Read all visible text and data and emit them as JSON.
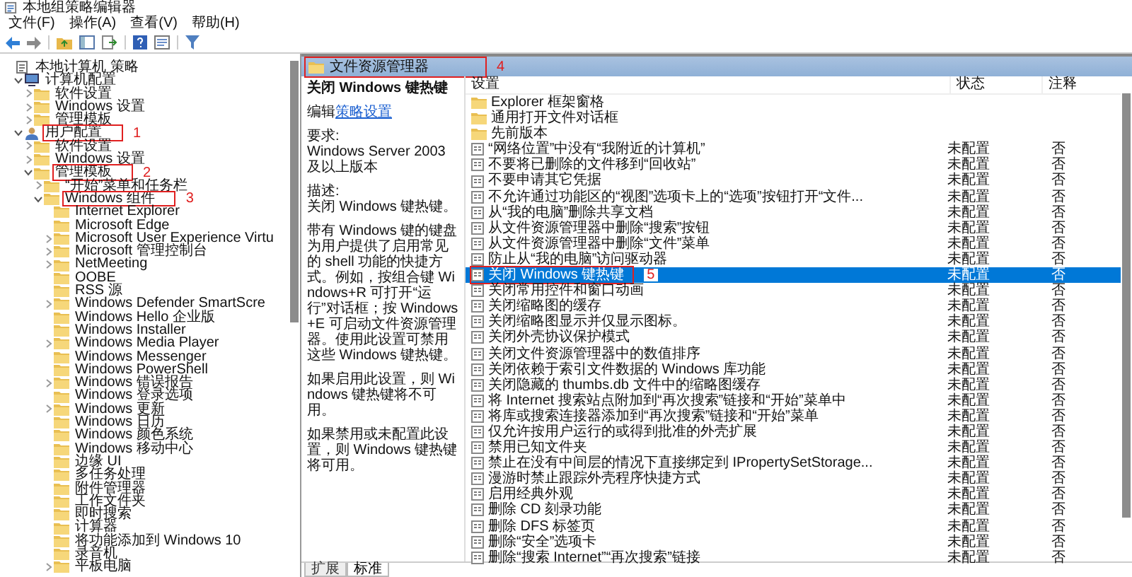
{
  "window": {
    "title": "本地组策略编辑器"
  },
  "menu": [
    "文件(F)",
    "操作(A)",
    "查看(V)",
    "帮助(H)"
  ],
  "tree": [
    {
      "kind": "policy",
      "label": "本地计算机 策略",
      "children": [
        {
          "kind": "computer",
          "label": "计算机配置",
          "expanded": true,
          "children": [
            {
              "kind": "folder",
              "label": "软件设置",
              "expanded": false
            },
            {
              "kind": "folder",
              "label": "Windows 设置",
              "expanded": false
            },
            {
              "kind": "folder",
              "label": "管理模板",
              "expanded": false
            }
          ]
        },
        {
          "kind": "user",
          "label": "用户配置",
          "expanded": true,
          "callout": "1",
          "children": [
            {
              "kind": "folder",
              "label": "软件设置",
              "expanded": false
            },
            {
              "kind": "folder",
              "label": "Windows 设置",
              "expanded": false
            },
            {
              "kind": "folder",
              "label": "管理模板",
              "expanded": true,
              "callout": "2",
              "children": [
                {
                  "kind": "folder",
                  "label": "“开始”菜单和任务栏",
                  "expanded": false
                },
                {
                  "kind": "folder",
                  "label": "Windows 组件",
                  "expanded": true,
                  "callout": "3",
                  "children": [
                    {
                      "kind": "folder",
                      "label": "Internet Explorer"
                    },
                    {
                      "kind": "folder",
                      "label": "Microsoft Edge"
                    },
                    {
                      "kind": "folder",
                      "label": "Microsoft User Experience Virtu",
                      "expanded": false
                    },
                    {
                      "kind": "folder",
                      "label": "Microsoft 管理控制台",
                      "expanded": false
                    },
                    {
                      "kind": "folder",
                      "label": "NetMeeting",
                      "expanded": false
                    },
                    {
                      "kind": "folder",
                      "label": "OOBE"
                    },
                    {
                      "kind": "folder",
                      "label": "RSS 源"
                    },
                    {
                      "kind": "folder",
                      "label": "Windows Defender SmartScre",
                      "expanded": false
                    },
                    {
                      "kind": "folder",
                      "label": "Windows Hello 企业版"
                    },
                    {
                      "kind": "folder",
                      "label": "Windows Installer"
                    },
                    {
                      "kind": "folder",
                      "label": "Windows Media Player",
                      "expanded": false
                    },
                    {
                      "kind": "folder",
                      "label": "Windows Messenger"
                    },
                    {
                      "kind": "folder",
                      "label": "Windows PowerShell"
                    },
                    {
                      "kind": "folder",
                      "label": "Windows 错误报告",
                      "expanded": false
                    },
                    {
                      "kind": "folder",
                      "label": "Windows 登录选项"
                    },
                    {
                      "kind": "folder",
                      "label": "Windows 更新",
                      "expanded": false
                    },
                    {
                      "kind": "folder",
                      "label": "Windows 日历"
                    },
                    {
                      "kind": "folder",
                      "label": "Windows 颜色系统"
                    },
                    {
                      "kind": "folder",
                      "label": "Windows 移动中心"
                    },
                    {
                      "kind": "folder",
                      "label": "边缘 UI"
                    },
                    {
                      "kind": "folder",
                      "label": "多任务处理"
                    },
                    {
                      "kind": "folder",
                      "label": "附件管理器"
                    },
                    {
                      "kind": "folder",
                      "label": "工作文件夹"
                    },
                    {
                      "kind": "folder",
                      "label": "即时搜索"
                    },
                    {
                      "kind": "folder",
                      "label": "计算器"
                    },
                    {
                      "kind": "folder",
                      "label": "将功能添加到 Windows 10"
                    },
                    {
                      "kind": "folder",
                      "label": "录音机"
                    },
                    {
                      "kind": "folder",
                      "label": "平板电脑",
                      "expanded": false
                    }
                  ]
                }
              ]
            }
          ]
        }
      ]
    }
  ],
  "header": {
    "title": "文件资源管理器",
    "callout": "4"
  },
  "description": {
    "title": "关闭 Windows 键热键",
    "edit_prefix": "编辑",
    "edit_link": "策略设置",
    "requirement_label": "要求:",
    "requirement": "Windows Server 2003 及以上版本",
    "description_label": "描述:",
    "paragraphs": [
      "关闭 Windows 键热键。",
      "带有 Windows 键的键盘为用户提供了启用常见的 shell 功能的快捷方式。例如，按组合键 Windows+R 可打开“运行”对话框；按 Windows+E 可启动文件资源管理器。使用此设置可禁用这些 Windows 键热键。",
      "如果启用此设置，则 Windows 键热键将不可用。",
      "如果禁用或未配置此设置，则 Windows 键热键将可用。"
    ]
  },
  "table": {
    "columns": [
      "设置",
      "状态",
      "注释"
    ],
    "rows": [
      {
        "kind": "folder",
        "name": "Explorer 框架窗格",
        "selected": false
      },
      {
        "kind": "folder",
        "name": "通用打开文件对话框",
        "selected": false
      },
      {
        "kind": "folder",
        "name": "先前版本",
        "selected": false
      },
      {
        "kind": "setting",
        "name": "“网络位置”中没有“我附近的计算机”",
        "state": "未配置",
        "comment": "否",
        "selected": false
      },
      {
        "kind": "setting",
        "name": "不要将已删除的文件移到“回收站”",
        "state": "未配置",
        "comment": "否",
        "selected": false
      },
      {
        "kind": "setting",
        "name": "不要申请其它凭据",
        "state": "未配置",
        "comment": "否",
        "selected": false
      },
      {
        "kind": "setting",
        "name": "不允许通过功能区的“视图”选项卡上的“选项”按钮打开“文件...",
        "state": "未配置",
        "comment": "否",
        "selected": false
      },
      {
        "kind": "setting",
        "name": "从“我的电脑”删除共享文档",
        "state": "未配置",
        "comment": "否",
        "selected": false
      },
      {
        "kind": "setting",
        "name": "从文件资源管理器中删除“搜索”按钮",
        "state": "未配置",
        "comment": "否",
        "selected": false
      },
      {
        "kind": "setting",
        "name": "从文件资源管理器中删除“文件”菜单",
        "state": "未配置",
        "comment": "否",
        "selected": false
      },
      {
        "kind": "setting",
        "name": "防止从“我的电脑”访问驱动器",
        "state": "未配置",
        "comment": "否",
        "selected": false
      },
      {
        "kind": "setting",
        "name": "关闭 Windows 键热键",
        "state": "未配置",
        "comment": "否",
        "selected": true,
        "callout": "5"
      },
      {
        "kind": "setting",
        "name": "关闭常用控件和窗口动画",
        "state": "未配置",
        "comment": "否",
        "selected": false
      },
      {
        "kind": "setting",
        "name": "关闭缩略图的缓存",
        "state": "未配置",
        "comment": "否",
        "selected": false
      },
      {
        "kind": "setting",
        "name": "关闭缩略图显示并仅显示图标。",
        "state": "未配置",
        "comment": "否",
        "selected": false
      },
      {
        "kind": "setting",
        "name": "关闭外壳协议保护模式",
        "state": "未配置",
        "comment": "否",
        "selected": false
      },
      {
        "kind": "setting",
        "name": "关闭文件资源管理器中的数值排序",
        "state": "未配置",
        "comment": "否",
        "selected": false
      },
      {
        "kind": "setting",
        "name": "关闭依赖于索引文件数据的 Windows 库功能",
        "state": "未配置",
        "comment": "否",
        "selected": false
      },
      {
        "kind": "setting",
        "name": "关闭隐藏的 thumbs.db 文件中的缩略图缓存",
        "state": "未配置",
        "comment": "否",
        "selected": false
      },
      {
        "kind": "setting",
        "name": "将 Internet 搜索站点附加到“再次搜索”链接和“开始”菜单中",
        "state": "未配置",
        "comment": "否",
        "selected": false
      },
      {
        "kind": "setting",
        "name": "将库或搜索连接器添加到“再次搜索”链接和“开始”菜单",
        "state": "未配置",
        "comment": "否",
        "selected": false
      },
      {
        "kind": "setting",
        "name": "仅允许按用户运行的或得到批准的外壳扩展",
        "state": "未配置",
        "comment": "否",
        "selected": false
      },
      {
        "kind": "setting",
        "name": "禁用已知文件夹",
        "state": "未配置",
        "comment": "否",
        "selected": false
      },
      {
        "kind": "setting",
        "name": "禁止在没有中间层的情况下直接绑定到 IPropertySetStorage...",
        "state": "未配置",
        "comment": "否",
        "selected": false
      },
      {
        "kind": "setting",
        "name": "漫游时禁止跟踪外壳程序快捷方式",
        "state": "未配置",
        "comment": "否",
        "selected": false
      },
      {
        "kind": "setting",
        "name": "启用经典外观",
        "state": "未配置",
        "comment": "否",
        "selected": false
      },
      {
        "kind": "setting",
        "name": "删除 CD 刻录功能",
        "state": "未配置",
        "comment": "否",
        "selected": false
      },
      {
        "kind": "setting",
        "name": "删除 DFS 标签页",
        "state": "未配置",
        "comment": "否",
        "selected": false
      },
      {
        "kind": "setting",
        "name": "删除“安全”选项卡",
        "state": "未配置",
        "comment": "否",
        "selected": false
      },
      {
        "kind": "setting",
        "name": "删除“搜索 Internet”“再次搜索”链接",
        "state": "未配置",
        "comment": "否",
        "selected": false
      }
    ]
  },
  "tabs": [
    {
      "label": "扩展",
      "selected": false
    },
    {
      "label": "标准",
      "selected": true
    }
  ]
}
